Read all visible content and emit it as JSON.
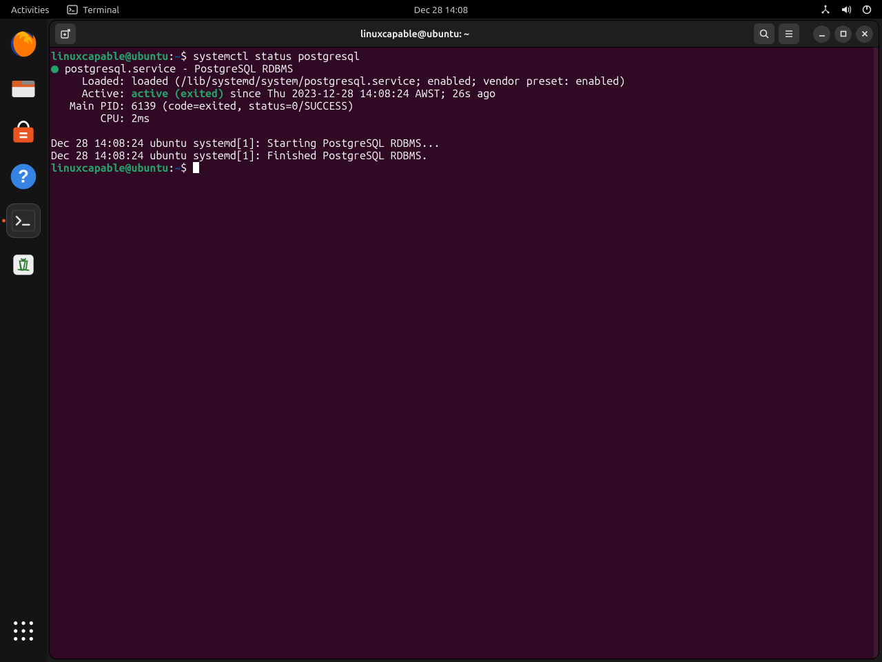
{
  "topbar": {
    "activities": "Activities",
    "app_label": "Terminal",
    "clock": "Dec 28  14:08"
  },
  "window": {
    "title": "linuxcapable@ubuntu: ~"
  },
  "prompt": {
    "user_host": "linuxcapable@ubuntu",
    "colon": ":",
    "path": "~",
    "dollar": "$"
  },
  "command": "systemctl status postgresql",
  "status": {
    "service_line": " postgresql.service - PostgreSQL RDBMS",
    "loaded": "     Loaded: loaded (/lib/systemd/system/postgresql.service; enabled; vendor preset: enabled)",
    "active_label": "     Active: ",
    "active_value": "active (exited)",
    "active_rest": " since Thu 2023-12-28 14:08:24 AWST; 26s ago",
    "main_pid": "   Main PID: 6139 (code=exited, status=0/SUCCESS)",
    "cpu": "        CPU: 2ms"
  },
  "journal": [
    "Dec 28 14:08:24 ubuntu systemd[1]: Starting PostgreSQL RDBMS...",
    "Dec 28 14:08:24 ubuntu systemd[1]: Finished PostgreSQL RDBMS."
  ]
}
